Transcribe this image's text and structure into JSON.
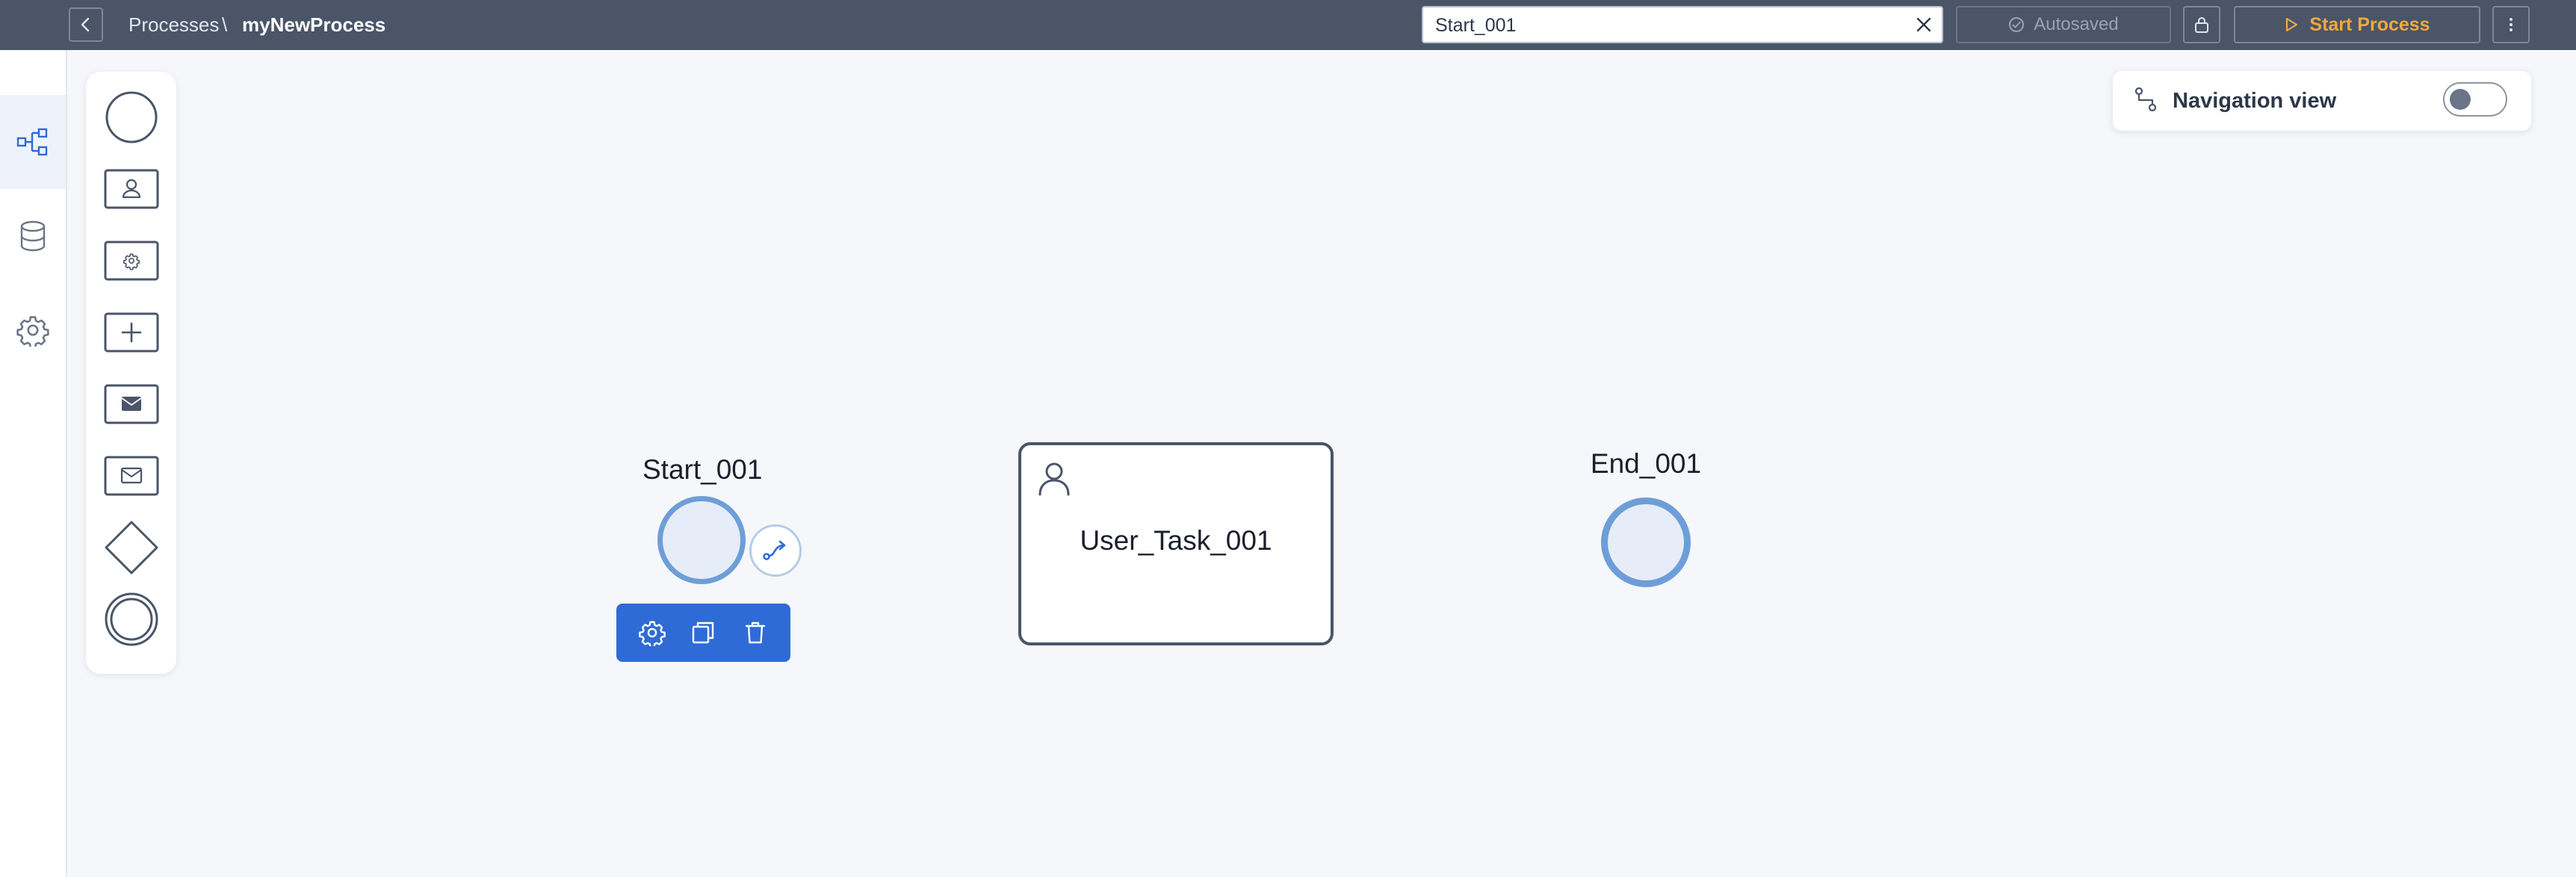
{
  "breadcrumb": {
    "root": "Processes",
    "separator": "\\",
    "current": "myNewProcess"
  },
  "search": {
    "value": "Start_001"
  },
  "status": {
    "autosaved": "Autosaved"
  },
  "actions": {
    "start_process": "Start Process"
  },
  "nav_view": {
    "label": "Navigation view",
    "enabled": false
  },
  "rail": {
    "items": [
      {
        "icon": "process-flow-icon",
        "active": true
      },
      {
        "icon": "database-icon",
        "active": false
      },
      {
        "icon": "settings-icon",
        "active": false
      }
    ]
  },
  "palette": {
    "items": [
      {
        "icon": "start-event-icon"
      },
      {
        "icon": "user-task-icon"
      },
      {
        "icon": "service-task-icon"
      },
      {
        "icon": "subprocess-icon"
      },
      {
        "icon": "send-task-icon"
      },
      {
        "icon": "receive-task-icon"
      },
      {
        "icon": "gateway-icon"
      },
      {
        "icon": "end-event-icon"
      }
    ]
  },
  "canvas": {
    "start_event": {
      "label": "Start_001"
    },
    "user_task": {
      "label": "User_Task_001"
    },
    "end_event": {
      "label": "End_001"
    }
  },
  "context_toolbar": {
    "buttons": [
      {
        "icon": "settings-icon"
      },
      {
        "icon": "copy-icon"
      },
      {
        "icon": "delete-icon"
      }
    ]
  },
  "colors": {
    "topbar": "#4a5568",
    "accent": "#2f6bd6",
    "start_button_text": "#f2a93b",
    "event_stroke": "#6e9ed8",
    "event_fill": "#e6edf8"
  }
}
